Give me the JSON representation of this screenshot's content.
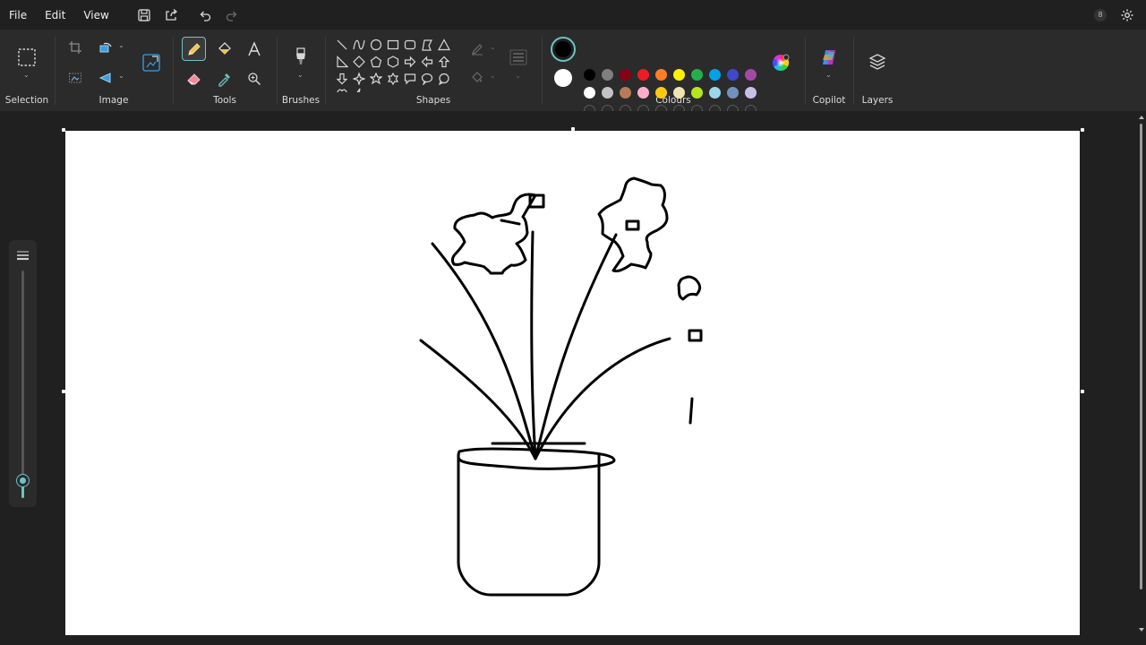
{
  "menu": {
    "file": "File",
    "edit": "Edit",
    "view": "View"
  },
  "quick_access": [
    "save-icon",
    "share-icon",
    "undo-icon",
    "redo-icon"
  ],
  "notification_count": "8",
  "ribbon": {
    "selection": "Selection",
    "image": "Image",
    "tools": "Tools",
    "brushes": "Brushes",
    "shapes": "Shapes",
    "colours": "Colours",
    "copilot": "Copilot",
    "layers": "Layers"
  },
  "colors": {
    "accent": "#6fc3c3",
    "primary": "#000000",
    "secondary": "#ffffff",
    "row1": [
      "#000000",
      "#7f7f7f",
      "#880015",
      "#ed1c24",
      "#ff7f27",
      "#fff200",
      "#22b14c",
      "#00a2e8",
      "#3f48cc",
      "#a349a4"
    ],
    "row2": [
      "#ffffff",
      "#c3c3c3",
      "#b97a57",
      "#ffaec9",
      "#ffc90e",
      "#efe4b0",
      "#b5e61d",
      "#99d9ea",
      "#7092be",
      "#c8bfe7"
    ],
    "custom_slots": 10
  },
  "brush_size_level": 0.07
}
